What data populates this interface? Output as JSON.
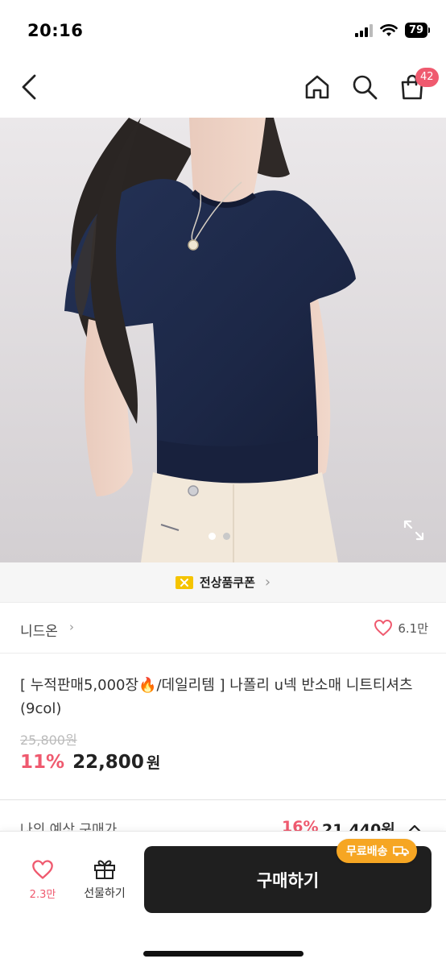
{
  "status_bar": {
    "time": "20:16",
    "battery": "79"
  },
  "nav": {
    "cart_badge": "42"
  },
  "gallery": {
    "pages": 2,
    "current_page": 1
  },
  "coupon": {
    "label": "전상품쿠폰",
    "chevron": "›"
  },
  "shop": {
    "name": "니드온",
    "chevron": "›",
    "like_count": "6.1만"
  },
  "product": {
    "title": "[ 누적판매5,000장🔥/데일리템 ] 나폴리 u넥 반소매 니트티셔츠 (9col)",
    "original_price": "25,800원",
    "discount_rate": "11%",
    "sale_price": "22,800",
    "sale_unit": "원"
  },
  "estimate": {
    "label": "나의 예상 구매가",
    "rate": "16%",
    "price": "21,440원"
  },
  "bottom_bar": {
    "wish_count": "2.3만",
    "gift_label": "선물하기",
    "buy_label": "구매하기",
    "free_shipping": "무료배송"
  },
  "colors": {
    "accent": "#ef5a6f",
    "buy_button": "#1f1f1f",
    "shipping_badge": "#f6a623",
    "coupon_icon": "#f5c400",
    "sweater": "#1e2a4a"
  },
  "icons": [
    "back-icon",
    "home-icon",
    "search-icon",
    "cart-icon",
    "expand-icon",
    "coupon-ticket-icon",
    "heart-icon",
    "gift-icon",
    "truck-icon",
    "chevron-up-icon",
    "signal-icon",
    "wifi-icon",
    "battery-icon"
  ]
}
